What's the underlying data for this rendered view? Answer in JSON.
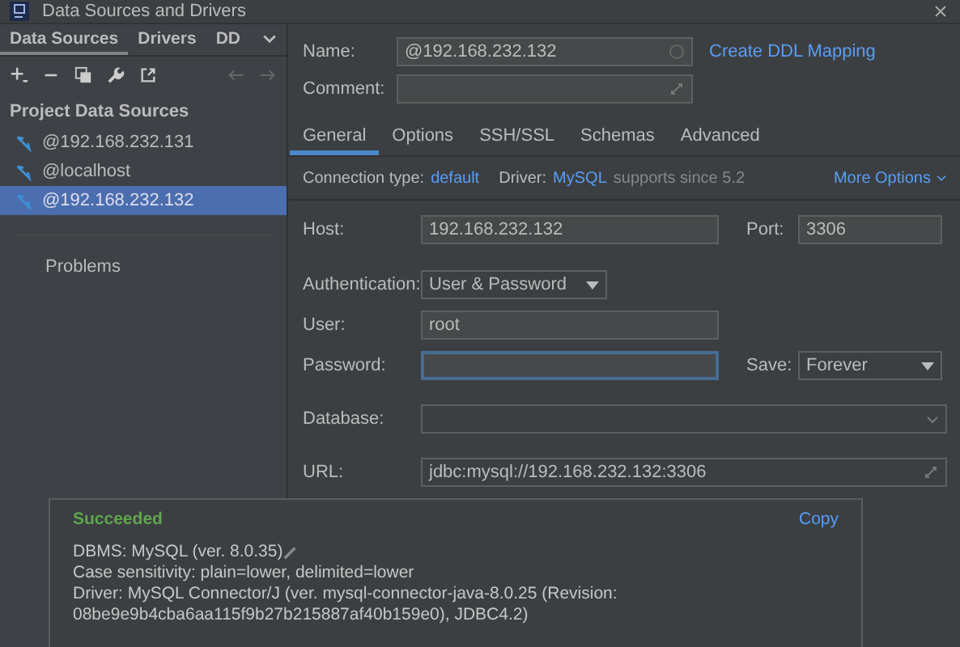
{
  "window": {
    "title": "Data Sources and Drivers"
  },
  "sidebar": {
    "tabs": [
      {
        "label": "Data Sources",
        "selected": true
      },
      {
        "label": "Drivers",
        "selected": false
      },
      {
        "label": "DD",
        "selected": false
      }
    ],
    "section": "Project Data Sources",
    "items": [
      {
        "label": "@192.168.232.131",
        "selected": false
      },
      {
        "label": "@localhost",
        "selected": false
      },
      {
        "label": "@192.168.232.132",
        "selected": true
      }
    ],
    "problems": "Problems"
  },
  "form": {
    "name_label": "Name:",
    "name_value": "@192.168.232.132",
    "ddl_link": "Create DDL Mapping",
    "comment_label": "Comment:",
    "tabs": [
      {
        "label": "General",
        "selected": true
      },
      {
        "label": "Options",
        "selected": false
      },
      {
        "label": "SSH/SSL",
        "selected": false
      },
      {
        "label": "Schemas",
        "selected": false
      },
      {
        "label": "Advanced",
        "selected": false
      }
    ],
    "connection_type_label": "Connection type:",
    "connection_type": "default",
    "driver_label": "Driver:",
    "driver": "MySQL",
    "driver_note": "supports since 5.2",
    "more_options": "More Options",
    "host_label": "Host:",
    "host": "192.168.232.132",
    "port_label": "Port:",
    "port": "3306",
    "auth_label": "Authentication:",
    "auth": "User & Password",
    "user_label": "User:",
    "user": "root",
    "password_label": "Password:",
    "password_focused": true,
    "save_label": "Save:",
    "save": "Forever",
    "database_label": "Database:",
    "url_label": "URL:",
    "url": "jdbc:mysql://192.168.232.132:3306"
  },
  "popup": {
    "status": "Succeeded",
    "copy": "Copy",
    "lines": [
      "DBMS: MySQL (ver. 8.0.35)",
      "Case sensitivity: plain=lower, delimited=lower",
      "Driver: MySQL Connector/J (ver. mysql-connector-java-8.0.25 (Revision:",
      "08be9e9b4cba6aa115f9b27b215887af40b159e0), JDBC4.2)"
    ]
  }
}
